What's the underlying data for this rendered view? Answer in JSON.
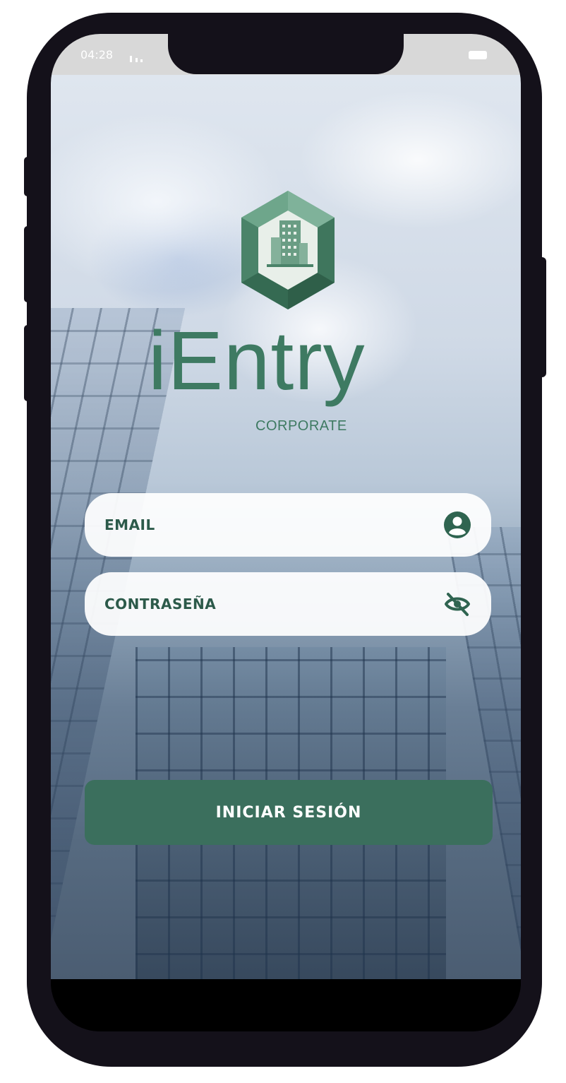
{
  "statusbar": {
    "time": "04:28",
    "signal_icon": "signal-bars-icon",
    "battery_icon": "battery-icon"
  },
  "brand": {
    "name": "iEntry",
    "subtitle": "CORPORATE",
    "logo_icon": "hexagon-building-logo-icon",
    "color": "#3e7a62"
  },
  "form": {
    "email": {
      "placeholder": "EMAIL",
      "value": "",
      "icon": "user-circle-icon"
    },
    "password": {
      "placeholder": "CONTRASEÑA",
      "value": "",
      "icon": "eye-off-icon"
    },
    "submit_label": "INICIAR SESIÓN"
  },
  "colors": {
    "accent": "#3b6f5d",
    "text": "#2c5a4a",
    "field_bg": "#ffffff",
    "phone_frame": "#14111a"
  }
}
